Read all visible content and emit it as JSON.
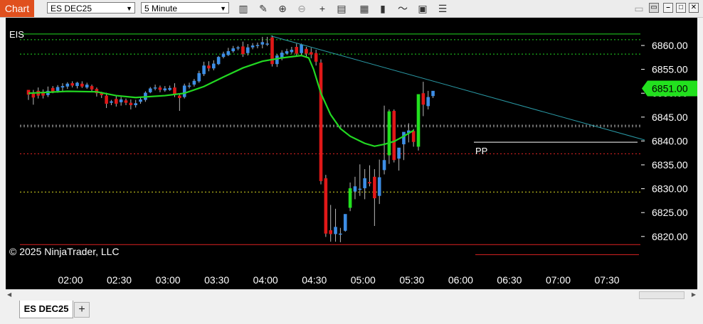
{
  "toolbar": {
    "tab_label": "Chart",
    "instrument": "ES DEC25",
    "interval": "5 Minute",
    "icons": [
      "bars-type-icon",
      "drawing-pencil-icon",
      "zoom-in-icon",
      "zoom-out-icon",
      "crosshair-icon",
      "data-box-icon",
      "indicators-icon",
      "strategies-icon",
      "templates-icon",
      "properties-icon"
    ]
  },
  "window": {
    "buttons": [
      "minimize",
      "maximize",
      "close"
    ]
  },
  "tabs": {
    "active": "ES DEC25",
    "add_label": "+"
  },
  "chart": {
    "indicator_label": "EIS",
    "copyright": "© 2025 NinjaTrader, LLC",
    "pivot_label": "PP",
    "last_price_label": "6851.00",
    "colors": {
      "background": "#000000",
      "up_candle": "#3d8ee6",
      "down_candle": "#e01818",
      "strong_up": "#22e01e",
      "ema": "#22d822",
      "trendline": "#2a9aa6",
      "price_marker": "#22e01e"
    }
  },
  "chart_data": {
    "type": "candlestick",
    "y_axis": {
      "ticks": [
        6820,
        6825,
        6830,
        6835,
        6840,
        6845,
        6850,
        6855,
        6860
      ],
      "tick_labels": [
        "6820.00",
        "6825.00",
        "6830.00",
        "6835.00",
        "6840.00",
        "6845.00",
        "6850.00",
        "6855.00",
        "6860.00"
      ],
      "range": [
        6817.5,
        6862.5
      ]
    },
    "x_axis": {
      "ticks": [
        "02:00",
        "02:30",
        "03:00",
        "03:30",
        "04:00",
        "04:30",
        "05:00",
        "05:30",
        "06:00",
        "06:30",
        "07:00",
        "07:30"
      ],
      "range_bars": [
        0,
        80
      ]
    },
    "last_price": 6851.0,
    "pivot_level": 6839.75,
    "horizontal_levels": [
      {
        "price": 6862.4,
        "color": "#22d822",
        "style": "solid"
      },
      {
        "price": 6861.2,
        "color": "#22d822",
        "style": "dotted"
      },
      {
        "price": 6858.2,
        "color": "#22d822",
        "style": "dotted"
      },
      {
        "price": 6843.3,
        "color": "#bbbbbb",
        "style": "dotted"
      },
      {
        "price": 6843.0,
        "color": "#bbbbbb",
        "style": "dotted"
      },
      {
        "price": 6837.3,
        "color": "#dd2222",
        "style": "dotted"
      },
      {
        "price": 6829.3,
        "color": "#dddd22",
        "style": "dotted"
      },
      {
        "price": 6818.3,
        "color": "#dd2222",
        "style": "solid"
      },
      {
        "price": 6816.2,
        "color": "#dd2222",
        "style": "solid"
      }
    ],
    "ema": [
      [
        0,
        6850.0
      ],
      [
        8,
        6850.4
      ],
      [
        14,
        6850.3
      ],
      [
        18,
        6849.5
      ],
      [
        22,
        6849.1
      ],
      [
        28,
        6849.5
      ],
      [
        32,
        6850.0
      ],
      [
        36,
        6851.4
      ],
      [
        40,
        6853.4
      ],
      [
        44,
        6855.3
      ],
      [
        48,
        6856.7
      ],
      [
        52,
        6857.4
      ],
      [
        56,
        6857.9
      ],
      [
        57.5,
        6857.4
      ],
      [
        58.5,
        6855.0
      ],
      [
        60,
        6850.0
      ],
      [
        62,
        6845.5
      ],
      [
        64,
        6842.6
      ],
      [
        66,
        6841.0
      ],
      [
        69,
        6839.5
      ],
      [
        71,
        6838.9
      ],
      [
        73,
        6839.3
      ],
      [
        75,
        6839.9
      ],
      [
        77,
        6841.0
      ],
      [
        79,
        6842.2
      ]
    ],
    "trendline": [
      [
        50,
        6862.0
      ],
      [
        80,
        6840.5
      ]
    ],
    "candles": [
      [
        0,
        6850.7,
        6850.6,
        6849.7,
        6848.6
      ],
      [
        1,
        6849.9,
        6850.7,
        6849.1,
        6847.6
      ],
      [
        2,
        6850.5,
        6851.2,
        6849.5,
        6848.9
      ],
      [
        3,
        6850.3,
        6850.8,
        6849.5,
        6848.9
      ],
      [
        4,
        6849.6,
        6851.4,
        6850.5,
        6849.2
      ],
      [
        5,
        6851.1,
        6851.5,
        6850.4,
        6850.0
      ],
      [
        6,
        6850.5,
        6851.7,
        6851.3,
        6850.1
      ],
      [
        7,
        6851.2,
        6852.1,
        6851.5,
        6850.5
      ],
      [
        8,
        6851.4,
        6852.3,
        6852.0,
        6850.9
      ],
      [
        9,
        6852.1,
        6852.5,
        6851.6,
        6851.2
      ],
      [
        10,
        6851.5,
        6852.4,
        6852.2,
        6851.0
      ],
      [
        11,
        6852.0,
        6852.5,
        6851.4,
        6851.1
      ],
      [
        12,
        6851.2,
        6852.2,
        6851.8,
        6850.9
      ],
      [
        13,
        6851.5,
        6851.8,
        6850.8,
        6850.3
      ],
      [
        14,
        6850.9,
        6851.2,
        6850.0,
        6849.3
      ],
      [
        15,
        6850.1,
        6850.3,
        6849.6,
        6849.0
      ],
      [
        16,
        6849.5,
        6850.1,
        6847.8,
        6846.9
      ],
      [
        17,
        6848.0,
        6848.6,
        6848.3,
        6847.5
      ],
      [
        18,
        6848.8,
        6849.4,
        6847.8,
        6847.2
      ],
      [
        19,
        6848.1,
        6849.2,
        6848.7,
        6847.4
      ],
      [
        20,
        6848.5,
        6848.9,
        6848.0,
        6847.5
      ],
      [
        21,
        6848.0,
        6848.7,
        6847.5,
        6846.6
      ],
      [
        22,
        6847.5,
        6848.6,
        6847.9,
        6847.0
      ],
      [
        23,
        6848.2,
        6849.3,
        6848.7,
        6847.8
      ],
      [
        24,
        6848.6,
        6850.4,
        6850.1,
        6848.2
      ],
      [
        25,
        6850.2,
        6851.3,
        6851.0,
        6850.0
      ],
      [
        26,
        6851.0,
        6851.8,
        6851.2,
        6850.6
      ],
      [
        27,
        6851.2,
        6851.6,
        6850.7,
        6850.2
      ],
      [
        28,
        6850.6,
        6851.5,
        6851.0,
        6850.3
      ],
      [
        29,
        6850.7,
        6851.6,
        6851.1,
        6850.5
      ],
      [
        30,
        6851.2,
        6852.1,
        6849.7,
        6849.2
      ],
      [
        31,
        6849.5,
        6850.0,
        6849.0,
        6846.3
      ],
      [
        32,
        6849.2,
        6852.0,
        6851.6,
        6848.9
      ],
      [
        33,
        6851.5,
        6852.2,
        6851.6,
        6851.0
      ],
      [
        34,
        6851.8,
        6853.0,
        6852.6,
        6851.4
      ],
      [
        35,
        6852.5,
        6854.7,
        6854.2,
        6852.2
      ],
      [
        36,
        6854.0,
        6856.6,
        6855.8,
        6853.6
      ],
      [
        37,
        6855.8,
        6856.7,
        6855.2,
        6854.6
      ],
      [
        38,
        6855.2,
        6856.9,
        6856.2,
        6854.8
      ],
      [
        39,
        6856.1,
        6857.8,
        6857.6,
        6855.9
      ],
      [
        40,
        6857.6,
        6858.7,
        6858.3,
        6857.3
      ],
      [
        41,
        6858.0,
        6859.5,
        6858.8,
        6857.8
      ],
      [
        42,
        6858.8,
        6859.9,
        6859.4,
        6858.5
      ],
      [
        43,
        6859.4,
        6859.9,
        6859.6,
        6859.0
      ],
      [
        44,
        6859.8,
        6860.8,
        6858.2,
        6857.6
      ],
      [
        45,
        6858.4,
        6860.3,
        6859.6,
        6857.9
      ],
      [
        46,
        6859.6,
        6860.5,
        6860.0,
        6859.2
      ],
      [
        47,
        6859.9,
        6860.6,
        6860.1,
        6859.4
      ],
      [
        48,
        6860.2,
        6861.8,
        6860.7,
        6859.4
      ],
      [
        49,
        6860.2,
        6861.8,
        6860.4,
        6859.9
      ],
      [
        50,
        6861.7,
        6862.1,
        6856.1,
        6855.6
      ],
      [
        51,
        6856.1,
        6858.2,
        6857.9,
        6855.5
      ],
      [
        52,
        6857.5,
        6859.0,
        6858.5,
        6856.9
      ],
      [
        53,
        6858.3,
        6859.3,
        6858.8,
        6858.1
      ],
      [
        54,
        6858.6,
        6859.7,
        6859.1,
        6858.3
      ],
      [
        55,
        6859.7,
        6860.4,
        6858.3,
        6857.9
      ],
      [
        56,
        6858.4,
        6860.4,
        6860.2,
        6857.8
      ],
      [
        57,
        6859.3,
        6859.7,
        6858.3,
        6857.5
      ],
      [
        58,
        6858.6,
        6859.5,
        6858.1,
        6857.3
      ],
      [
        59,
        6858.4,
        6859.1,
        6856.6,
        6855.8
      ],
      [
        60,
        6856.4,
        6857.1,
        6831.6,
        6830.9
      ],
      [
        61,
        6832.2,
        6832.9,
        6820.6,
        6819.9
      ],
      [
        62,
        6821.3,
        6826.6,
        6820.5,
        6818.9
      ],
      [
        63,
        6820.5,
        6825.8,
        6822.0,
        6818.9
      ],
      [
        64,
        6820.6,
        6821.8,
        6820.6,
        6818.8
      ],
      [
        65,
        6821.2,
        6822.9,
        6824.7,
        6821.0
      ],
      [
        66,
        6826.0,
        6831.3,
        6830.1,
        6825.3
      ],
      [
        67,
        6829.4,
        6832.5,
        6830.5,
        6827.8
      ],
      [
        68,
        6829.8,
        6835.1,
        6830.0,
        6828.5
      ],
      [
        69,
        6830.1,
        6834.1,
        6832.2,
        6827.8
      ],
      [
        70,
        6831.4,
        6834.9,
        6831.1,
        6830.5
      ],
      [
        71,
        6832.5,
        6834.1,
        6828.0,
        6822.2
      ],
      [
        72,
        6828.5,
        6836.1,
        6832.4,
        6826.8
      ],
      [
        73,
        6833.9,
        6847.4,
        6836.0,
        6833.0
      ],
      [
        74,
        6837.0,
        6846.6,
        6846.2,
        6835.2
      ],
      [
        75,
        6846.3,
        6846.6,
        6836.0,
        6835.5
      ],
      [
        76,
        6836.3,
        6837.3,
        6838.6,
        6833.8
      ],
      [
        77,
        6839.3,
        6840.3,
        6841.9,
        6836.0
      ],
      [
        78,
        6841.7,
        6843.7,
        6842.2,
        6839.7
      ],
      [
        79,
        6842.1,
        6842.5,
        6839.8,
        6838.8
      ],
      [
        80,
        6838.8,
        6843.7,
        6849.8,
        6838.0
      ],
      [
        81,
        6850.0,
        6852.4,
        6847.6,
        6845.2
      ],
      [
        82,
        6847.3,
        6850.5,
        6849.2,
        6846.6
      ],
      [
        83,
        6849.4,
        6850.2,
        6850.5,
        6849.0
      ]
    ]
  }
}
